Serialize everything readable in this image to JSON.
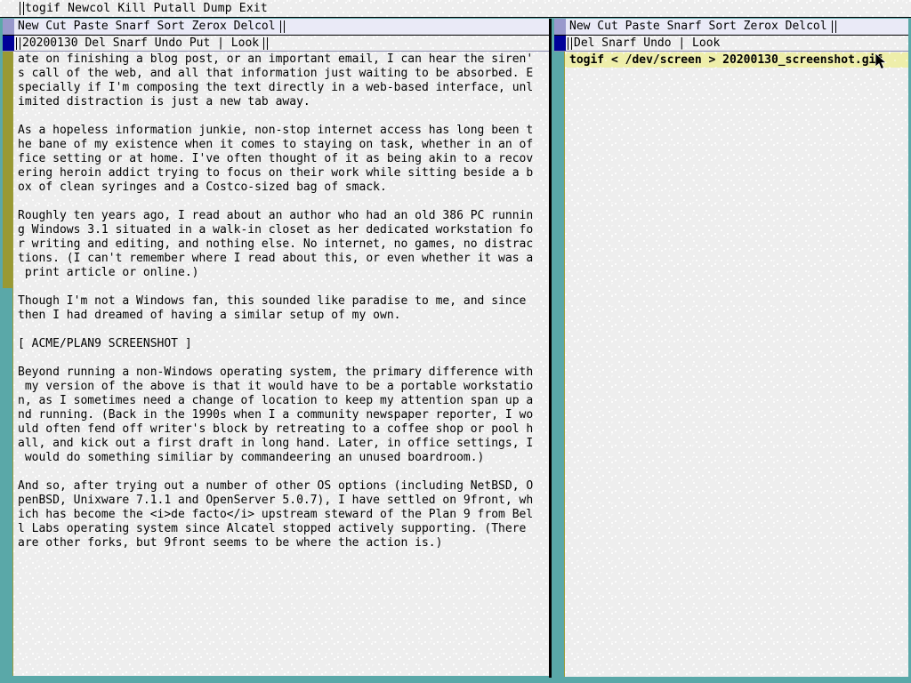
{
  "topbar": {
    "menu": "togif Newcol Kill Putall Dump Exit"
  },
  "left_column": {
    "column_tag": "New Cut Paste Snarf Sort Zerox Delcol",
    "window": {
      "tag": "20200130 Del Snarf Undo Put | Look",
      "filename": "20200130",
      "commands": [
        "Del",
        "Snarf",
        "Undo",
        "Put",
        "Look"
      ],
      "body": "ate on finishing a blog post, or an important email, I can hear the siren'\ns call of the web, and all that information just waiting to be absorbed. E\nspecially if I'm composing the text directly in a web-based interface, unl\nimited distraction is just a new tab away.\n\nAs a hopeless information junkie, non-stop internet access has long been t\nhe bane of my existence when it comes to staying on task, whether in an of\nfice setting or at home. I've often thought of it as being akin to a recov\nering heroin addict trying to focus on their work while sitting beside a b\nox of clean syringes and a Costco-sized bag of smack.\n\nRoughly ten years ago, I read about an author who had an old 386 PC runnin\ng Windows 3.1 situated in a walk-in closet as her dedicated workstation fo\nr writing and editing, and nothing else. No internet, no games, no distrac\ntions. (I can't remember where I read about this, or even whether it was a\n print article or online.)\n\nThough I'm not a Windows fan, this sounded like paradise to me, and since\nthen I had dreamed of having a similar setup of my own.\n\n[ ACME/PLAN9 SCREENSHOT ]\n\nBeyond running a non-Windows operating system, the primary difference with\n my version of the above is that it would have to be a portable workstatio\nn, as I sometimes need a change of location to keep my attention span up a\nnd running. (Back in the 1990s when I a community newspaper reporter, I wo\nuld often fend off writer's block by retreating to a coffee shop or pool h\nall, and kick out a first draft in long hand. Later, in office settings, I\n would do something similiar by commandeering an unused boardroom.)\n\nAnd so, after trying out a number of other OS options (including NetBSD, O\npenBSD, Unixware 7.1.1 and OpenServer 5.0.7), I have settled on 9front, wh\nich has become the <i>de facto</i> upstream steward of the Plan 9 from Bel\nl Labs operating system since Alcatel stopped actively supporting. (There\nare other forks, but 9front seems to be where the action is.)"
    }
  },
  "right_column": {
    "column_tag": "New Cut Paste Snarf Sort Zerox Delcol",
    "window": {
      "tag": "Del Snarf Undo | Look",
      "commands": [
        "Del",
        "Snarf",
        "Undo",
        "Look"
      ],
      "command_line": "togif < /dev/screen > 20200130_screenshot.gif"
    }
  },
  "colors": {
    "desktop_teal": "#5aa8a8",
    "paper": "#eeeeee",
    "tag_yellow": "#eeeeaa",
    "column_grip": "#9999cc",
    "window_grip": "#000099",
    "scroll_thumb": "#999933",
    "coltag_bg": "#eaeaf7"
  },
  "icons": {
    "pointer": "mouse-pointer-icon",
    "column_grip": "column-grip-icon",
    "window_grip": "window-grip-icon"
  }
}
